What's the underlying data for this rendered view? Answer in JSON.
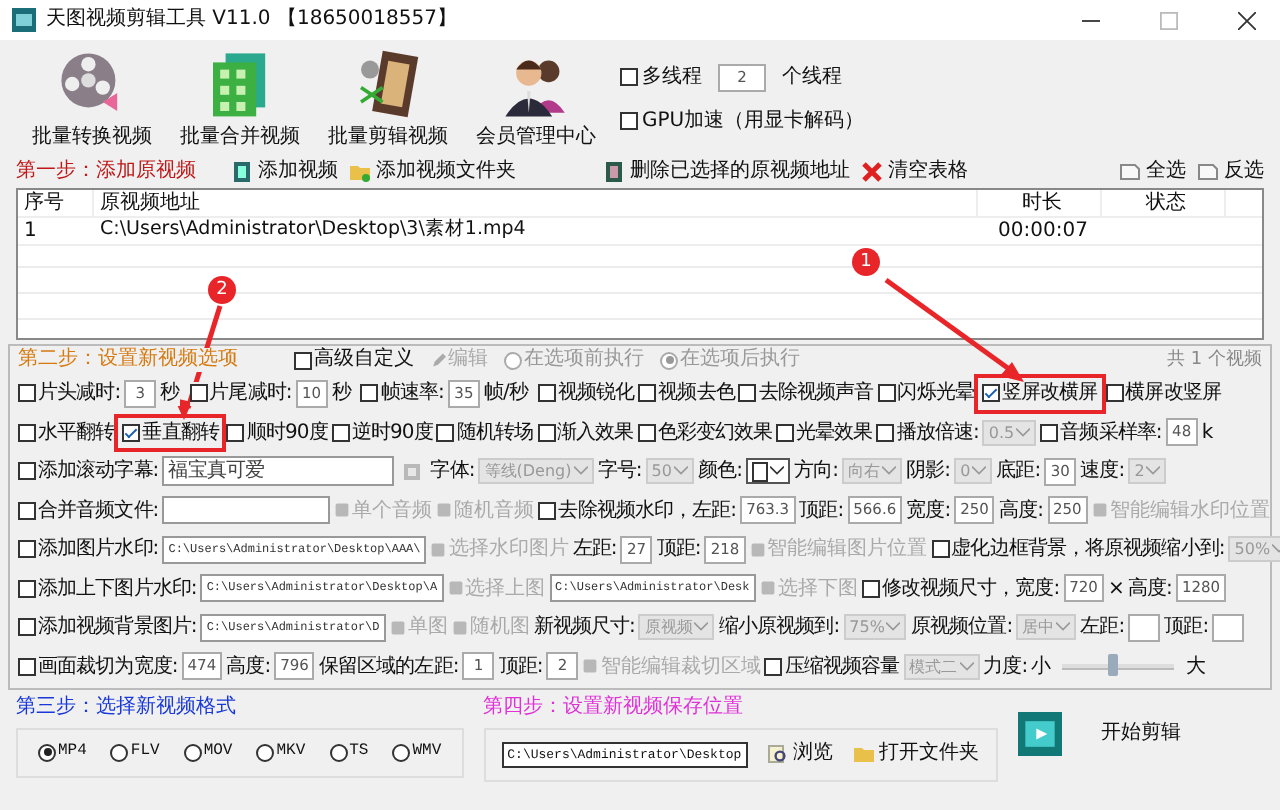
{
  "window": {
    "title": "天图视频剪辑工具 V11.0 【18650018557】"
  },
  "toolbar": [
    {
      "label": "批量转换视频",
      "kind": "reel"
    },
    {
      "label": "批量合并视频",
      "kind": "grid"
    },
    {
      "label": "批量剪辑视频",
      "kind": "film"
    },
    {
      "label": "会员管理中心",
      "kind": "people"
    }
  ],
  "threads": {
    "multi": {
      "label": "多线程",
      "checked": false
    },
    "count": "2",
    "unit": "个线程",
    "gpu": {
      "label": "GPU加速（用显卡解码）",
      "checked": false
    }
  },
  "step1": {
    "title": "第一步：添加原视频",
    "actions": [
      {
        "label": "添加视频",
        "kind": "add"
      },
      {
        "label": "添加视频文件夹",
        "kind": "folder"
      },
      {
        "label": "删除已选择的原视频地址",
        "kind": "delete"
      },
      {
        "label": "清空表格",
        "kind": "clear"
      }
    ],
    "selectors": [
      {
        "label": "全选"
      },
      {
        "label": "反选"
      }
    ]
  },
  "table": {
    "columns": [
      "序号",
      "原视频地址",
      "时长",
      "状态"
    ],
    "rows": [
      {
        "index": "1",
        "path": "C:\\Users\\Administrator\\Desktop\\3\\素材1.mp4",
        "duration": "00:00:07"
      }
    ]
  },
  "step2": {
    "title": "第二步：设置新视频选项",
    "count": "共 1 个视频",
    "header": [
      {
        "kind": "check",
        "label": "高级自定义",
        "checked": false
      },
      {
        "kind": "tool",
        "label": "编辑",
        "disabled": true
      },
      {
        "kind": "radio",
        "label": "在选项前执行",
        "selected": false,
        "disabled": true
      },
      {
        "kind": "radio",
        "label": "在选项后执行",
        "selected": true,
        "disabled": true
      }
    ],
    "rows": [
      {
        "items": [
          {
            "kind": "check",
            "label": "片头减时:",
            "checked": false
          },
          {
            "kind": "num",
            "value": "3"
          },
          {
            "kind": "label",
            "text": "秒"
          },
          {
            "kind": "check",
            "label": "片尾减时:",
            "checked": false
          },
          {
            "kind": "num",
            "value": "10"
          },
          {
            "kind": "label",
            "text": "秒"
          },
          {
            "kind": "check",
            "label": "帧速率:",
            "checked": false
          },
          {
            "kind": "num",
            "value": "35"
          },
          {
            "kind": "label",
            "text": "帧/秒"
          },
          {
            "kind": "check",
            "label": "视频锐化",
            "checked": false
          },
          {
            "kind": "check",
            "label": "视频去色",
            "checked": false
          },
          {
            "kind": "check",
            "label": "去除视频声音",
            "checked": false
          },
          {
            "kind": "check",
            "label": "闪烁光晕",
            "checked": false
          },
          {
            "kind": "check",
            "label": "竖屏改横屏",
            "checked": true,
            "highlighted": true
          },
          {
            "kind": "check",
            "label": "横屏改竖屏",
            "checked": false
          }
        ]
      },
      {
        "items": [
          {
            "kind": "check",
            "label": "水平翻转",
            "checked": false
          },
          {
            "kind": "check",
            "label": "垂直翻转",
            "checked": true,
            "highlighted": true
          },
          {
            "kind": "check",
            "label": "顺时90度",
            "checked": false
          },
          {
            "kind": "check",
            "label": "逆时90度",
            "checked": false
          },
          {
            "kind": "check",
            "label": "随机转场",
            "checked": false
          },
          {
            "kind": "check",
            "label": "渐入效果",
            "checked": false
          },
          {
            "kind": "check",
            "label": "色彩变幻效果",
            "checked": false
          },
          {
            "kind": "check",
            "label": "光晕效果",
            "checked": false
          },
          {
            "kind": "check",
            "label": "播放倍速:",
            "checked": false
          },
          {
            "kind": "select",
            "value": "0.5",
            "disabled": true
          },
          {
            "kind": "check",
            "label": "音频采样率:",
            "checked": false
          },
          {
            "kind": "num",
            "value": "48"
          },
          {
            "kind": "label",
            "text": "k"
          }
        ]
      },
      {
        "items": [
          {
            "kind": "check",
            "label": "添加滚动字幕:",
            "checked": false
          },
          {
            "kind": "text",
            "value": "福宝真可爱"
          },
          {
            "kind": "tool",
            "disabled": true
          },
          {
            "kind": "label",
            "text": "字体:"
          },
          {
            "kind": "select",
            "value": "等线(Deng)",
            "disabled": true
          },
          {
            "kind": "label",
            "text": "字号:"
          },
          {
            "kind": "select",
            "value": "50",
            "disabled": true
          },
          {
            "kind": "label",
            "text": "颜色:"
          },
          {
            "kind": "color"
          },
          {
            "kind": "label",
            "text": "方向:"
          },
          {
            "kind": "select",
            "value": "向右",
            "disabled": true
          },
          {
            "kind": "label",
            "text": "阴影:"
          },
          {
            "kind": "select",
            "value": "0",
            "disabled": true
          },
          {
            "kind": "label",
            "text": "底距:"
          },
          {
            "kind": "num",
            "value": "30"
          },
          {
            "kind": "label",
            "text": "速度:"
          },
          {
            "kind": "select",
            "value": "2",
            "disabled": true
          }
        ]
      },
      {
        "items": [
          {
            "kind": "check",
            "label": "合并音频文件:",
            "checked": false
          },
          {
            "kind": "path"
          },
          {
            "kind": "tool",
            "label": "单个音频",
            "disabled": true
          },
          {
            "kind": "tool",
            "label": "随机音频",
            "disabled": true
          },
          {
            "kind": "check",
            "label": "去除视频水印，左距:",
            "checked": false
          },
          {
            "kind": "num",
            "value": "763.3"
          },
          {
            "kind": "label",
            "text": "顶距:"
          },
          {
            "kind": "num",
            "value": "566.6"
          },
          {
            "kind": "label",
            "text": "宽度:"
          },
          {
            "kind": "num",
            "value": "250"
          },
          {
            "kind": "label",
            "text": "高度:"
          },
          {
            "kind": "num",
            "value": "250"
          },
          {
            "kind": "tool",
            "label": "智能编辑水印位置",
            "disabled": true
          }
        ]
      },
      {
        "items": [
          {
            "kind": "check",
            "label": "添加图片水印:",
            "checked": false
          },
          {
            "kind": "path",
            "value": "C:\\Users\\Administrator\\Desktop\\AAA\\"
          },
          {
            "kind": "tool",
            "label": "选择水印图片",
            "disabled": true
          },
          {
            "kind": "label",
            "text": "左距:"
          },
          {
            "kind": "num",
            "value": "27"
          },
          {
            "kind": "label",
            "text": "顶距:"
          },
          {
            "kind": "num",
            "value": "218"
          },
          {
            "kind": "tool",
            "label": "智能编辑图片位置",
            "disabled": true
          },
          {
            "kind": "check",
            "label": "虚化边框背景，将原视频缩小到:",
            "checked": false
          },
          {
            "kind": "select",
            "value": "50%",
            "disabled": true
          }
        ]
      },
      {
        "items": [
          {
            "kind": "check",
            "label": "添加上下图片水印:",
            "checked": false
          },
          {
            "kind": "path",
            "value": "C:\\Users\\Administrator\\Desktop\\A"
          },
          {
            "kind": "tool",
            "label": "选择上图",
            "disabled": true
          },
          {
            "kind": "path",
            "value": "C:\\Users\\Administrator\\Desk"
          },
          {
            "kind": "tool",
            "label": "选择下图",
            "disabled": true
          },
          {
            "kind": "check",
            "label": "修改视频尺寸，宽度:",
            "checked": false
          },
          {
            "kind": "num",
            "value": "720"
          },
          {
            "kind": "label",
            "text": "×"
          },
          {
            "kind": "label",
            "text": "高度:"
          },
          {
            "kind": "num",
            "value": "1280"
          }
        ]
      },
      {
        "items": [
          {
            "kind": "check",
            "label": "添加视频背景图片:",
            "checked": false
          },
          {
            "kind": "path",
            "value": "C:\\Users\\Administrator\\D"
          },
          {
            "kind": "tool",
            "label": "单图",
            "disabled": true
          },
          {
            "kind": "tool",
            "label": "随机图",
            "disabled": true
          },
          {
            "kind": "label",
            "text": "新视频尺寸:"
          },
          {
            "kind": "select",
            "value": "原视频",
            "disabled": true
          },
          {
            "kind": "label",
            "text": "缩小原视频到:"
          },
          {
            "kind": "select",
            "value": "75%",
            "disabled": true
          },
          {
            "kind": "label",
            "text": "原视频位置:"
          },
          {
            "kind": "select",
            "value": "居中",
            "disabled": true
          },
          {
            "kind": "label",
            "text": "左距:"
          },
          {
            "kind": "num"
          },
          {
            "kind": "label",
            "text": "顶距:"
          },
          {
            "kind": "num"
          }
        ]
      },
      {
        "items": [
          {
            "kind": "check",
            "label": "画面裁切为宽度:",
            "checked": false
          },
          {
            "kind": "num",
            "value": "474"
          },
          {
            "kind": "label",
            "text": "高度:"
          },
          {
            "kind": "num",
            "value": "796"
          },
          {
            "kind": "label",
            "text": "保留区域的左距:"
          },
          {
            "kind": "num",
            "value": "1"
          },
          {
            "kind": "label",
            "text": "顶距:"
          },
          {
            "kind": "num",
            "value": "2"
          },
          {
            "kind": "tool",
            "label": "智能编辑裁切区域",
            "disabled": true
          },
          {
            "kind": "check",
            "label": "压缩视频容量",
            "checked": false
          },
          {
            "kind": "select",
            "value": "模式二",
            "disabled": true
          },
          {
            "kind": "label",
            "text": "力度:"
          },
          {
            "kind": "label",
            "text": "小"
          },
          {
            "kind": "slider",
            "level": 0.45
          },
          {
            "kind": "label",
            "text": "大"
          }
        ]
      }
    ]
  },
  "step3": {
    "title": "第三步：选择新视频格式",
    "formats": [
      {
        "label": "MP4",
        "selected": true
      },
      {
        "label": "FLV",
        "selected": false
      },
      {
        "label": "MOV",
        "selected": false
      },
      {
        "label": "MKV",
        "selected": false
      },
      {
        "label": "TS",
        "selected": false
      },
      {
        "label": "WMV",
        "selected": false
      }
    ]
  },
  "step4": {
    "title": "第四步：设置新视频保存位置",
    "path": "C:\\Users\\Administrator\\Desktop",
    "actions": [
      {
        "label": "浏览",
        "kind": "browse"
      },
      {
        "label": "打开文件夹",
        "kind": "folder"
      }
    ]
  },
  "start": {
    "label": "开始剪辑"
  },
  "annotations": [
    {
      "number": "1"
    },
    {
      "number": "2"
    }
  ]
}
